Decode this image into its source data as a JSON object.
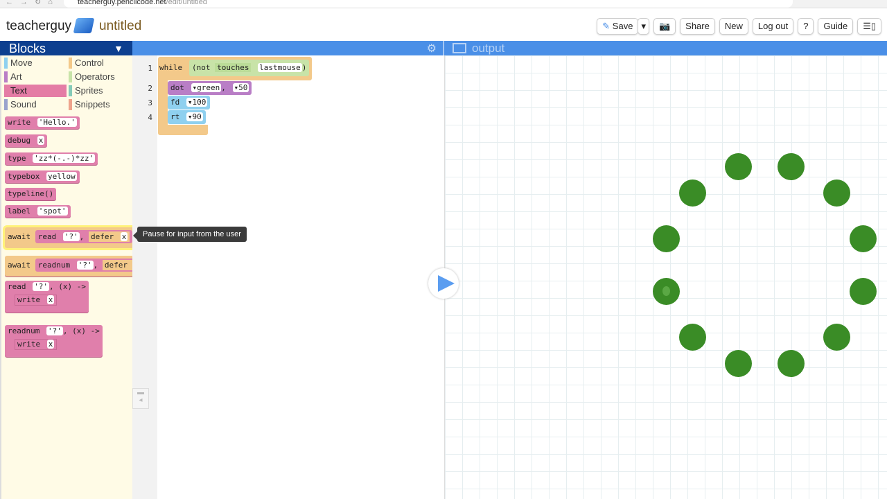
{
  "browser": {
    "url_host": "teacherguy.pencilcode.net",
    "url_path": "/edit/untitled"
  },
  "header": {
    "user": "teacherguy",
    "filename": "untitled",
    "buttons": {
      "save": "Save",
      "share": "Share",
      "new": "New",
      "logout": "Log out",
      "help": "?",
      "guide": "Guide"
    }
  },
  "palette": {
    "title": "Blocks",
    "categories": [
      {
        "label": "Move",
        "color": "#8fd0ef"
      },
      {
        "label": "Control",
        "color": "#f3c98a"
      },
      {
        "label": "Art",
        "color": "#b97ec6"
      },
      {
        "label": "Operators",
        "color": "#c8e3a8"
      },
      {
        "label": "Text",
        "color": "#e47ca5"
      },
      {
        "label": "Sprites",
        "color": "#86cbb8"
      },
      {
        "label": "Sound",
        "color": "#9aa3cd"
      },
      {
        "label": "Snippets",
        "color": "#eea38c"
      }
    ],
    "blocks": [
      {
        "kw": "write",
        "arg": "'Hello.'"
      },
      {
        "kw": "debug",
        "arg": "x"
      },
      {
        "kw": "type",
        "arg": "'zz*(-.-)*zz'"
      },
      {
        "kw": "typebox",
        "arg": "yellow"
      },
      {
        "kw": "typeline()",
        "arg": ""
      },
      {
        "kw": "label",
        "arg": "'spot'"
      },
      {
        "kw": "await",
        "fn": "read",
        "arg": "'?'",
        "defer": "defer",
        "x": "x"
      },
      {
        "kw": "await",
        "fn": "readnum",
        "arg": "'?'",
        "defer": "defer",
        "x": "x"
      },
      {
        "kw": "read",
        "arg": "'?'",
        "param": "(x) ->",
        "inner": "write",
        "innerArg": "x"
      },
      {
        "kw": "readnum",
        "arg": "'?'",
        "param": "(x) ->",
        "inner": "write",
        "innerArg": "x"
      }
    ],
    "tooltip": "Pause for input from the user"
  },
  "editor": {
    "lines": [
      "1",
      "2",
      "3",
      "4"
    ],
    "while": "while",
    "cond_not": "(not",
    "cond_fn": "touches",
    "cond_arg": "lastmouse",
    "cond_close": ")",
    "dot": "dot",
    "dot_color": "green",
    "dot_size": "50",
    "fd": "fd",
    "fd_val": "100",
    "rt": "rt",
    "rt_val": "90"
  },
  "output": {
    "title": "output",
    "dot_color": "#3a8c26"
  }
}
